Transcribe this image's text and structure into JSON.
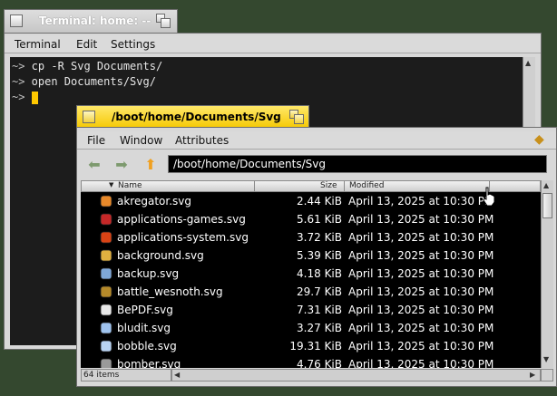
{
  "terminal": {
    "title": "Terminal: home: --",
    "menu": [
      "Terminal",
      "Edit",
      "Settings"
    ],
    "lines": [
      {
        "prompt": "~>",
        "command": " cp -R Svg Documents/"
      },
      {
        "prompt": "~>",
        "command": " open Documents/Svg/"
      },
      {
        "prompt": "~>",
        "command": " "
      }
    ]
  },
  "tracker": {
    "title": "/boot/home/Documents/Svg",
    "menu": [
      "File",
      "Window",
      "Attributes"
    ],
    "path": "/boot/home/Documents/Svg",
    "columns": {
      "name": "Name",
      "size": "Size",
      "modified": "Modified"
    },
    "files": [
      {
        "name": "akregator.svg",
        "size": "2.44 KiB",
        "modified": "April 13, 2025 at 10:30 PM",
        "icon": "rss-feed-icon",
        "color": "#e8892a"
      },
      {
        "name": "applications-games.svg",
        "size": "5.61 KiB",
        "modified": "April 13, 2025 at 10:30 PM",
        "icon": "joystick-icon",
        "color": "#c62828"
      },
      {
        "name": "applications-system.svg",
        "size": "3.72 KiB",
        "modified": "April 13, 2025 at 10:30 PM",
        "icon": "system-tools-icon",
        "color": "#d84315"
      },
      {
        "name": "background.svg",
        "size": "5.39 KiB",
        "modified": "April 13, 2025 at 10:30 PM",
        "icon": "paint-brush-icon",
        "color": "#e0b040"
      },
      {
        "name": "backup.svg",
        "size": "4.18 KiB",
        "modified": "April 13, 2025 at 10:30 PM",
        "icon": "backup-icon",
        "color": "#7fa8d8"
      },
      {
        "name": "battle_wesnoth.svg",
        "size": "29.7 KiB",
        "modified": "April 13, 2025 at 10:30 PM",
        "icon": "wesnoth-shield-icon",
        "color": "#b58a2a"
      },
      {
        "name": "BePDF.svg",
        "size": "7.31 KiB",
        "modified": "April 13, 2025 at 10:30 PM",
        "icon": "pdf-document-icon",
        "color": "#e8e8e8"
      },
      {
        "name": "bludit.svg",
        "size": "3.27 KiB",
        "modified": "April 13, 2025 at 10:30 PM",
        "icon": "diamond-icon",
        "color": "#9fc3ee"
      },
      {
        "name": "bobble.svg",
        "size": "19.31 KiB",
        "modified": "April 13, 2025 at 10:30 PM",
        "icon": "diamond-icon",
        "color": "#b9d3f2"
      },
      {
        "name": "bomber.svg",
        "size": "4.76 KiB",
        "modified": "April 13, 2025 at 10:30 PM",
        "icon": "bomb-icon",
        "color": "#9a9a9a"
      }
    ],
    "status": "64 items"
  },
  "colors": {
    "desktop": "#34482f",
    "terminal_tab": "#d0d0d0",
    "tracker_tab": "#f5c800",
    "cursor": "#ffc800",
    "nav_up_arrow": "#f0a020"
  }
}
